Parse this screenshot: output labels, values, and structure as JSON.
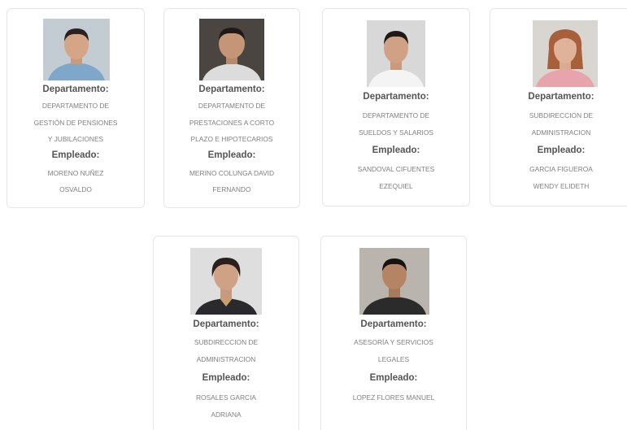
{
  "labels": {
    "department": "Departamento:",
    "employee": "Empleado:"
  },
  "cards": [
    {
      "department": [
        "DEPARTAMENTO DE",
        "GESTIÓN DE PENSIONES",
        "Y JUBILACIONES"
      ],
      "employee": [
        "MORENO NUÑEZ",
        "OSVALDO"
      ],
      "photo": "man-portrait-blue-shirt"
    },
    {
      "department": [
        "DEPARTAMENTO DE",
        "PRESTACIONES A CORTO",
        "PLAZO E HIPOTECARIOS"
      ],
      "employee": [
        "MERINO COLUNGA DAVID",
        "FERNANDO"
      ],
      "photo": "man-portrait-dark-background"
    },
    {
      "department": [
        "DEPARTAMENTO DE",
        "SUELDOS Y SALARIOS"
      ],
      "employee": [
        "SANDOVAL CIFUENTES",
        "EZEQUIEL"
      ],
      "photo": "man-portrait-white-shirt"
    },
    {
      "department": [
        "SUBDIRECCION DE",
        "ADMINISTRACION"
      ],
      "employee": [
        "GARCIA FIGUEROA",
        "WENDY ELIDETH"
      ],
      "photo": "woman-portrait-pink-top"
    },
    {
      "department": [
        "SUBDIRECCION DE",
        "ADMINISTRACION"
      ],
      "employee": [
        "ROSALES GARCIA",
        "ADRIANA"
      ],
      "photo": "woman-portrait-dark-hair"
    },
    {
      "department": [
        "ASESORÍA Y SERVICIOS",
        "LEGALES"
      ],
      "employee": [
        "LOPEZ FLORES MANUEL"
      ],
      "photo": "man-portrait-dark-shirt"
    }
  ],
  "colors": {
    "card_border": "#e6e6e6",
    "label_text": "#555555",
    "value_text": "#808080"
  }
}
